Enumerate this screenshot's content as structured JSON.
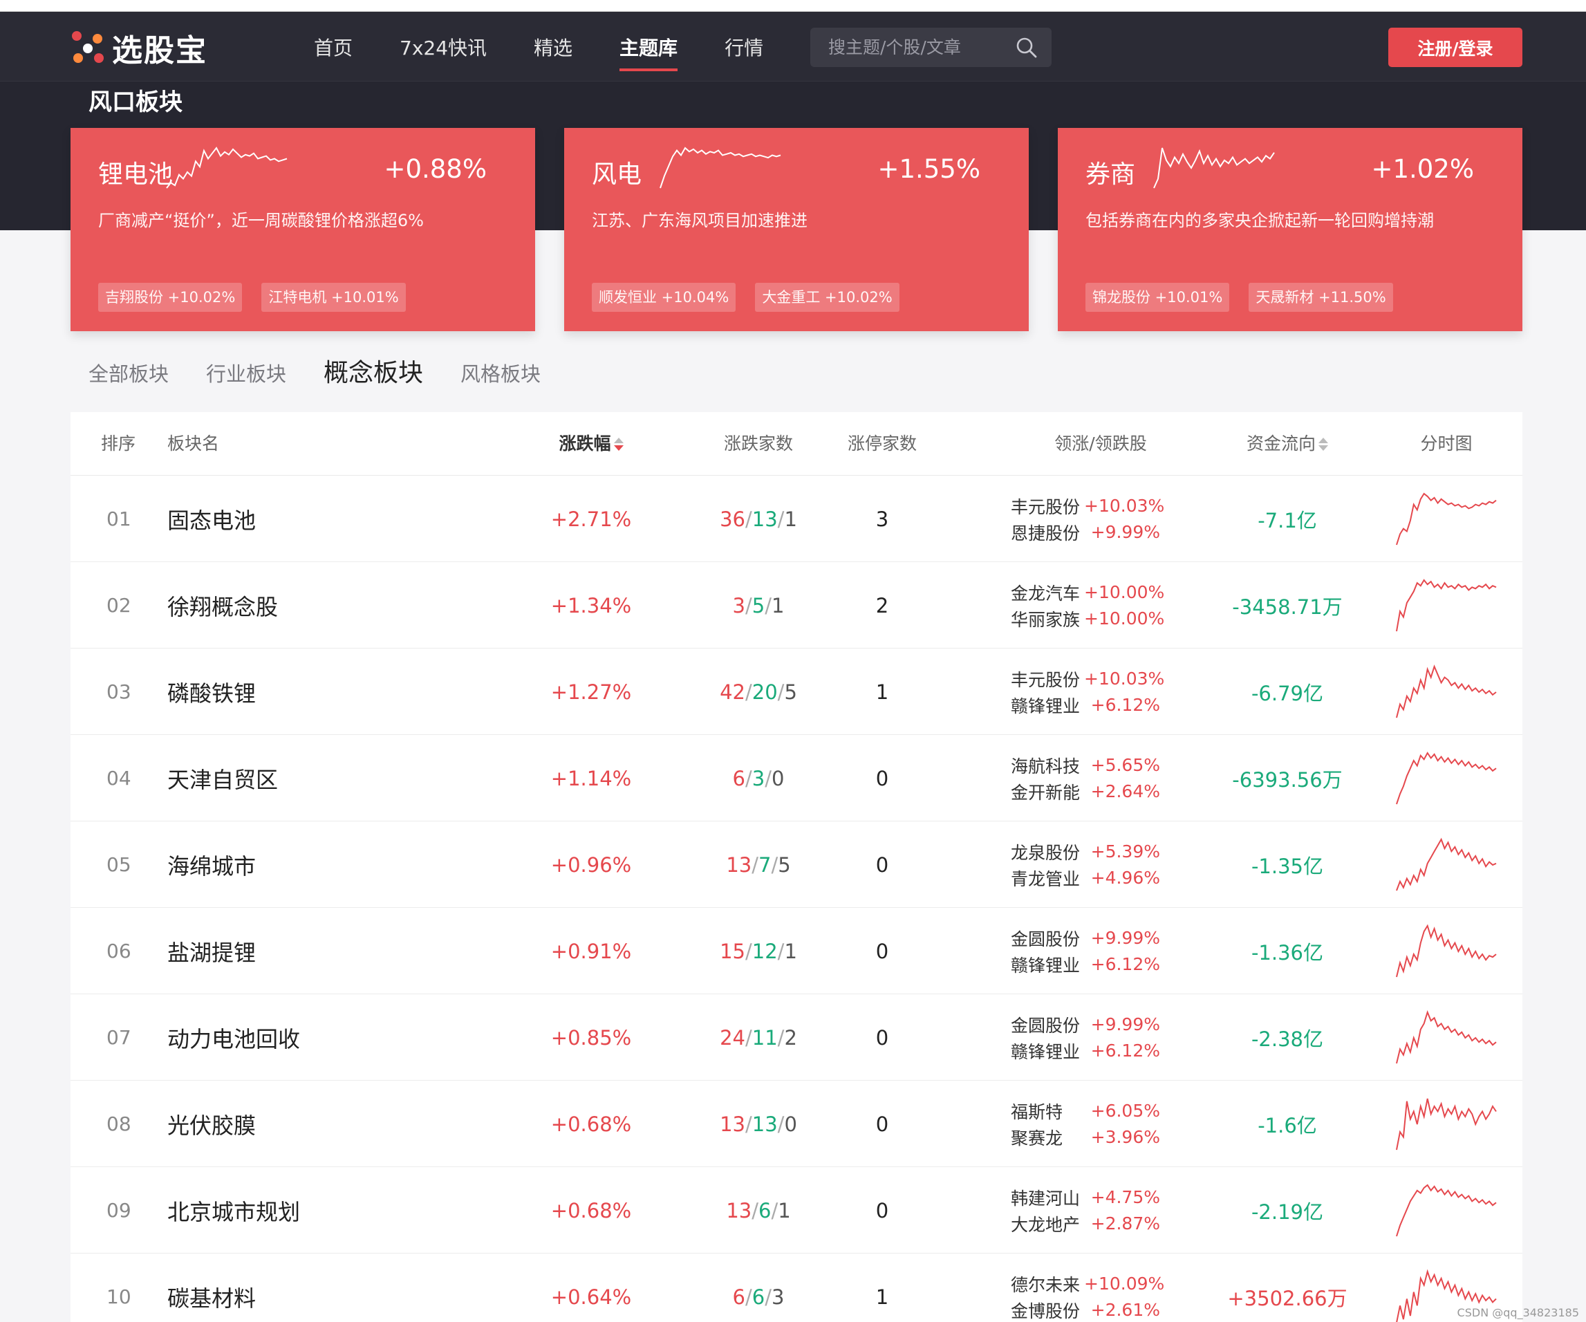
{
  "brand": {
    "name": "选股宝",
    "dot_colors": [
      "#e5484d",
      "#ff8a3d",
      "#e5484d",
      "#ff8a3d"
    ]
  },
  "nav": [
    {
      "label": "首页",
      "active": false
    },
    {
      "label": "7x24快讯",
      "active": false
    },
    {
      "label": "精选",
      "active": false
    },
    {
      "label": "主题库",
      "active": true
    },
    {
      "label": "行情",
      "active": false
    }
  ],
  "search": {
    "placeholder": "搜主题/个股/文章"
  },
  "login": {
    "label": "注册/登录"
  },
  "section_title": "风口板块",
  "hot_cards": [
    {
      "name": "锂电池",
      "pct": "+0.88%",
      "desc": "厂商减产“挺价”，近一周碳酸锂价格涨超6%",
      "stocks": [
        "吉翔股份 +10.02%",
        "江特电机 +10.01%"
      ],
      "spark": [
        2,
        6,
        4,
        12,
        9,
        14,
        11,
        22,
        18,
        30,
        24,
        28,
        32,
        26,
        29,
        27,
        31,
        28,
        25,
        27,
        26,
        28,
        24,
        25,
        26,
        23,
        24,
        22,
        23,
        24
      ]
    },
    {
      "name": "风电",
      "pct": "+1.55%",
      "desc": "江苏、广东海风项目加速推进",
      "stocks": [
        "顺发恒业 +10.04%",
        "大金重工 +10.02%"
      ],
      "spark": [
        0,
        10,
        18,
        26,
        31,
        27,
        33,
        30,
        32,
        29,
        31,
        28,
        30,
        29,
        31,
        27,
        28,
        29,
        27,
        28,
        26,
        27,
        28,
        26,
        27,
        26,
        25,
        27,
        26,
        27
      ]
    },
    {
      "name": "券商",
      "pct": "+1.02%",
      "desc": "包括券商在内的多家央企掀起新一轮回购增持潮",
      "stocks": [
        "锦龙股份 +10.01%",
        "天晟新材 +11.50%"
      ],
      "spark": [
        4,
        10,
        30,
        22,
        18,
        24,
        20,
        26,
        21,
        17,
        22,
        28,
        20,
        25,
        19,
        23,
        18,
        22,
        20,
        24,
        19,
        21,
        23,
        20,
        22,
        24,
        21,
        25,
        23,
        27
      ]
    }
  ],
  "tabs": [
    {
      "label": "全部板块",
      "active": false
    },
    {
      "label": "行业板块",
      "active": false
    },
    {
      "label": "概念板块",
      "active": true
    },
    {
      "label": "风格板块",
      "active": false
    }
  ],
  "table": {
    "headers": {
      "rank": "排序",
      "name": "板块名",
      "chg": "涨跌幅",
      "counts": "涨跌家数",
      "limit": "涨停家数",
      "leaders": "领涨/领跌股",
      "flow": "资金流向",
      "chart": "分时图"
    },
    "rows": [
      {
        "rank": "01",
        "name": "固态电池",
        "chg": "+2.71%",
        "up": "36",
        "down": "13",
        "flat": "1",
        "limit": "3",
        "l1": "丰元股份",
        "p1": "+10.03%",
        "l2": "恩捷股份",
        "p2": "+9.99%",
        "flow": "-7.1亿",
        "flow_dir": "neg",
        "spark": [
          0,
          8,
          12,
          10,
          18,
          30,
          26,
          34,
          38,
          36,
          33,
          35,
          31,
          34,
          32,
          30,
          31,
          29,
          30,
          28,
          29,
          27,
          28,
          30,
          29,
          31,
          30,
          32,
          31,
          33
        ]
      },
      {
        "rank": "02",
        "name": "徐翔概念股",
        "chg": "+1.34%",
        "up": "3",
        "down": "5",
        "flat": "1",
        "limit": "2",
        "l1": "金龙汽车",
        "p1": "+10.00%",
        "l2": "华丽家族",
        "p2": "+10.00%",
        "flow": "-3458.71万",
        "flow_dir": "neg",
        "spark": [
          0,
          14,
          10,
          20,
          24,
          28,
          34,
          32,
          36,
          33,
          35,
          31,
          33,
          30,
          34,
          31,
          32,
          30,
          33,
          31,
          32,
          29,
          31,
          30,
          32,
          31,
          33,
          30,
          32,
          31
        ]
      },
      {
        "rank": "03",
        "name": "磷酸铁锂",
        "chg": "+1.27%",
        "up": "42",
        "down": "20",
        "flat": "5",
        "limit": "1",
        "l1": "丰元股份",
        "p1": "+10.03%",
        "l2": "赣锋锂业",
        "p2": "+6.12%",
        "flow": "-6.79亿",
        "flow_dir": "neg",
        "spark": [
          0,
          10,
          6,
          16,
          12,
          22,
          18,
          28,
          22,
          36,
          30,
          38,
          32,
          26,
          30,
          28,
          24,
          26,
          22,
          25,
          21,
          24,
          20,
          22,
          19,
          21,
          18,
          20,
          17,
          19
        ]
      },
      {
        "rank": "04",
        "name": "天津自贸区",
        "chg": "+1.14%",
        "up": "6",
        "down": "3",
        "flat": "0",
        "limit": "0",
        "l1": "海航科技",
        "p1": "+5.65%",
        "l2": "金开新能",
        "p2": "+2.64%",
        "flow": "-6393.56万",
        "flow_dir": "neg",
        "spark": [
          0,
          8,
          14,
          22,
          28,
          34,
          30,
          38,
          35,
          40,
          36,
          39,
          34,
          37,
          33,
          36,
          32,
          35,
          31,
          34,
          30,
          33,
          29,
          31,
          28,
          30,
          27,
          29,
          26,
          28
        ]
      },
      {
        "rank": "05",
        "name": "海绵城市",
        "chg": "+0.96%",
        "up": "13",
        "down": "7",
        "flat": "5",
        "limit": "0",
        "l1": "龙泉股份",
        "p1": "+5.39%",
        "l2": "青龙管业",
        "p2": "+4.96%",
        "flow": "-1.35亿",
        "flow_dir": "neg",
        "spark": [
          4,
          10,
          6,
          12,
          8,
          14,
          10,
          18,
          14,
          22,
          26,
          30,
          34,
          38,
          32,
          36,
          30,
          33,
          28,
          31,
          26,
          29,
          24,
          27,
          22,
          25,
          20,
          23,
          21,
          22
        ]
      },
      {
        "rank": "06",
        "name": "盐湖提锂",
        "chg": "+0.91%",
        "up": "15",
        "down": "12",
        "flat": "1",
        "limit": "0",
        "l1": "金圆股份",
        "p1": "+9.99%",
        "l2": "赣锋锂业",
        "p2": "+6.12%",
        "flow": "-1.36亿",
        "flow_dir": "neg",
        "spark": [
          2,
          12,
          6,
          16,
          10,
          18,
          14,
          26,
          34,
          38,
          30,
          36,
          28,
          32,
          24,
          28,
          22,
          26,
          20,
          24,
          18,
          22,
          16,
          20,
          15,
          18,
          14,
          17,
          16,
          18
        ]
      },
      {
        "rank": "07",
        "name": "动力电池回收",
        "chg": "+0.85%",
        "up": "24",
        "down": "11",
        "flat": "2",
        "limit": "0",
        "l1": "金圆股份",
        "p1": "+9.99%",
        "l2": "赣锋锂业",
        "p2": "+6.12%",
        "flow": "-2.38亿",
        "flow_dir": "neg",
        "spark": [
          2,
          12,
          8,
          16,
          10,
          20,
          14,
          26,
          30,
          38,
          32,
          34,
          28,
          30,
          26,
          28,
          24,
          26,
          22,
          24,
          20,
          22,
          18,
          20,
          17,
          19,
          16,
          18,
          15,
          17
        ]
      },
      {
        "rank": "08",
        "name": "光伏胶膜",
        "chg": "+0.68%",
        "up": "13",
        "down": "13",
        "flat": "0",
        "limit": "0",
        "l1": "福斯特",
        "p1": "+6.05%",
        "l2": "聚赛龙",
        "p2": "+3.96%",
        "flow": "-1.6亿",
        "flow_dir": "neg",
        "spark": [
          0,
          14,
          10,
          38,
          24,
          30,
          20,
          34,
          26,
          40,
          28,
          34,
          30,
          36,
          26,
          32,
          28,
          34,
          24,
          30,
          26,
          32,
          28,
          20,
          26,
          30,
          24,
          28,
          34,
          30
        ]
      },
      {
        "rank": "09",
        "name": "北京城市规划",
        "chg": "+0.68%",
        "up": "13",
        "down": "6",
        "flat": "1",
        "limit": "0",
        "l1": "韩建河山",
        "p1": "+4.75%",
        "l2": "大龙地产",
        "p2": "+2.87%",
        "flow": "-2.19亿",
        "flow_dir": "neg",
        "spark": [
          0,
          8,
          14,
          20,
          26,
          30,
          34,
          32,
          36,
          38,
          34,
          37,
          33,
          35,
          31,
          34,
          30,
          33,
          29,
          31,
          28,
          30,
          26,
          28,
          25,
          27,
          24,
          26,
          23,
          25
        ]
      },
      {
        "rank": "10",
        "name": "碳基材料",
        "chg": "+0.64%",
        "up": "6",
        "down": "6",
        "flat": "3",
        "limit": "1",
        "l1": "德尔未来",
        "p1": "+10.09%",
        "l2": "金博股份",
        "p2": "+2.61%",
        "flow": "+3502.66万",
        "flow_dir": "pos",
        "spark": [
          4,
          14,
          6,
          18,
          8,
          22,
          14,
          30,
          26,
          34,
          28,
          32,
          26,
          30,
          24,
          28,
          22,
          26,
          20,
          24,
          18,
          22,
          17,
          21,
          16,
          20,
          17,
          19,
          16,
          18
        ]
      }
    ]
  },
  "watermark": "CSDN @qq_34823185",
  "colors": {
    "up": "#e5484d",
    "down": "#1aaa7a",
    "dark": "#262630"
  }
}
